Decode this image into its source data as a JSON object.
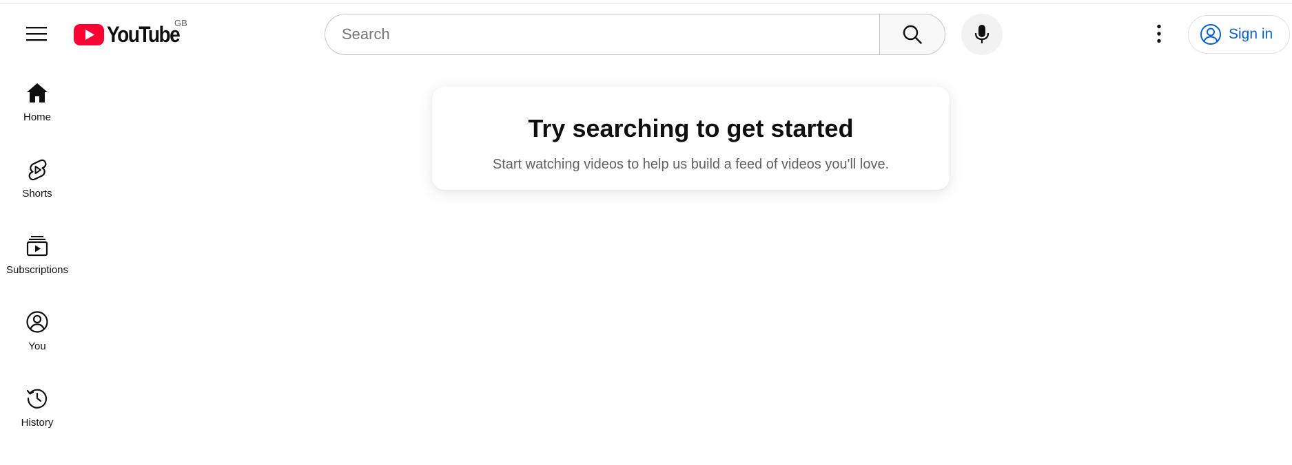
{
  "colors": {
    "brand_red": "#ff0033",
    "link_blue": "#065fd4",
    "text_primary": "#0f0f0f",
    "text_secondary": "#606060"
  },
  "masthead": {
    "menu_icon": "hamburger-menu-icon",
    "logo_text": "YouTube",
    "country_code": "GB",
    "search": {
      "placeholder": "Search",
      "value": ""
    },
    "search_icon": "search-icon",
    "mic_icon": "microphone-icon",
    "more_icon": "vertical-dots-icon",
    "sign_in_label": "Sign in",
    "sign_in_icon": "account-circle-icon"
  },
  "guide": {
    "items": [
      {
        "label": "Home",
        "icon": "home-icon"
      },
      {
        "label": "Shorts",
        "icon": "shorts-icon"
      },
      {
        "label": "Subscriptions",
        "icon": "subscriptions-icon"
      },
      {
        "label": "You",
        "icon": "account-circle-icon"
      },
      {
        "label": "History",
        "icon": "history-icon"
      }
    ]
  },
  "feed": {
    "title": "Try searching to get started",
    "subtitle": "Start watching videos to help us build a feed of videos you'll love."
  }
}
